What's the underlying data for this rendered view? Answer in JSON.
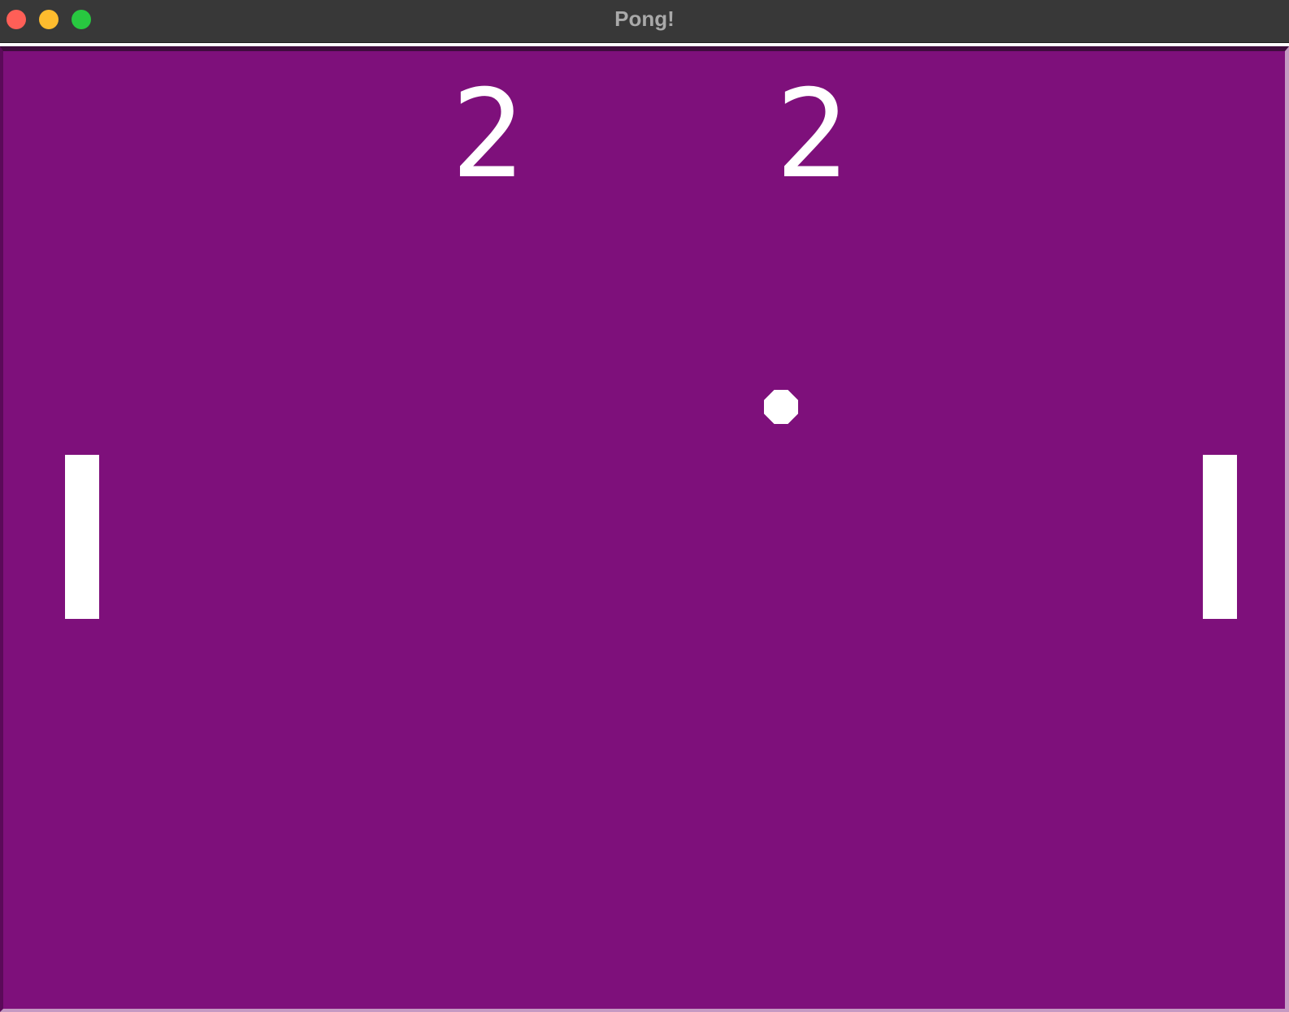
{
  "window": {
    "title": "Pong!",
    "controls": {
      "close_color": "#ff5f57",
      "minimize_color": "#febc2e",
      "zoom_color": "#28c840"
    }
  },
  "game": {
    "background_color": "#7e107b",
    "foreground_color": "#ffffff",
    "score": {
      "left": "2",
      "right": "2"
    },
    "objects": {
      "left_paddle": "paddle",
      "right_paddle": "paddle",
      "ball": "ball"
    }
  }
}
